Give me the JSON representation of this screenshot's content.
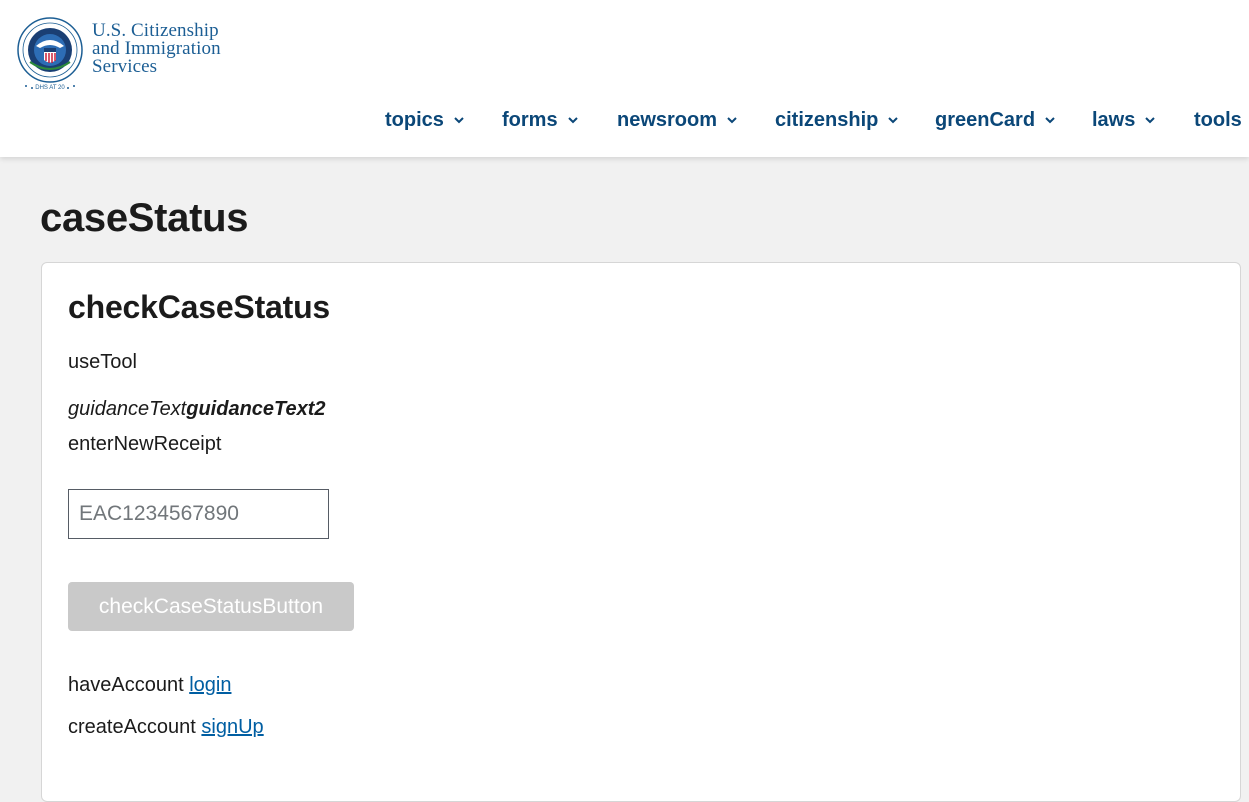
{
  "header": {
    "agency_line1": "U.S. Citizenship",
    "agency_line2": "and Immigration",
    "agency_line3": "Services",
    "seal_text": "DHS AT 20"
  },
  "nav": {
    "items": [
      {
        "label": "topics",
        "has_dropdown": true
      },
      {
        "label": "forms",
        "has_dropdown": true
      },
      {
        "label": "newsroom",
        "has_dropdown": true
      },
      {
        "label": "citizenship",
        "has_dropdown": true
      },
      {
        "label": "greenCard",
        "has_dropdown": true
      },
      {
        "label": "laws",
        "has_dropdown": true
      },
      {
        "label": "tools",
        "has_dropdown": false
      }
    ]
  },
  "page": {
    "title": "caseStatus"
  },
  "card": {
    "title": "checkCaseStatus",
    "use_tool": "useTool",
    "guidance_text": "guidanceText",
    "guidance_text2": "guidanceText2",
    "enter_new_receipt": "enterNewReceipt",
    "receipt_placeholder": "EAC1234567890",
    "receipt_value": "",
    "check_button_label": "checkCaseStatusButton",
    "check_button_disabled": true,
    "have_account": "haveAccount",
    "login_link": "login",
    "create_account": "createAccount",
    "signup_link": "signUp"
  },
  "colors": {
    "nav_text": "#0b4778",
    "link": "#005ea2",
    "agency_text": "#1c5e94",
    "button_disabled": "#c9c9c9",
    "page_bg": "#f1f1f1"
  }
}
